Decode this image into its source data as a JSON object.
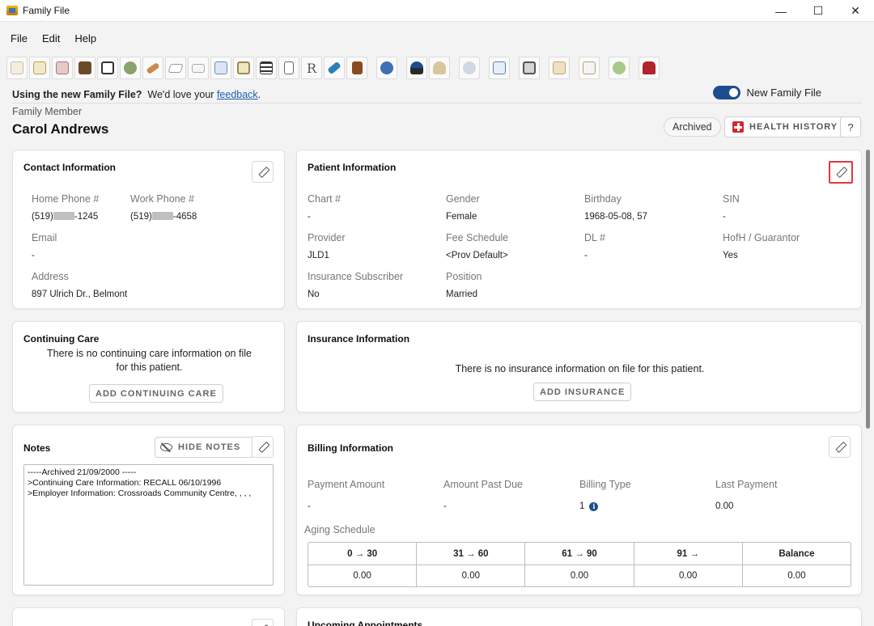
{
  "window": {
    "title": "Family File",
    "minimize": "—",
    "maximize": "☐",
    "close": "✕"
  },
  "menu": [
    "File",
    "Edit",
    "Help"
  ],
  "toolbar": {
    "icons": [
      "tooth-icon",
      "notepad-icon",
      "book-icon",
      "chair-icon",
      "id-card-icon",
      "globe-icon",
      "bandage-icon",
      "eraser-icon",
      "card-icon",
      "calendar-clock-icon",
      "camera-icon",
      "layout-icon",
      "document-icon",
      "rx-icon",
      "pen-icon",
      "door-icon",
      "info-icon",
      "person-icon",
      "family-icon",
      "people-icon",
      "calendar-icon",
      "printer-icon",
      "scroll-icon",
      "certificate-icon",
      "money-icon",
      "reader-icon"
    ],
    "rx_label": "R"
  },
  "banner": {
    "lead": "Using the new Family File?",
    "text": "We'd love your",
    "link": "feedback",
    "end": ".",
    "toggle_label": "New Family File"
  },
  "member": {
    "label": "Family Member",
    "name": "Carol Andrews"
  },
  "header_actions": {
    "archived": "Archived",
    "health_history": "HEALTH HISTORY",
    "help": "?"
  },
  "contact": {
    "title": "Contact Information",
    "home_phone_label": "Home Phone #",
    "home_phone_prefix": "(519)",
    "home_phone_suffix": "-1245",
    "work_phone_label": "Work Phone #",
    "work_phone_prefix": "(519)",
    "work_phone_suffix": "-4658",
    "email_label": "Email",
    "email_value": "-",
    "address_label": "Address",
    "address_value": "897 Ulrich Dr., Belmont"
  },
  "patient": {
    "title": "Patient Information",
    "fields": [
      {
        "label": "Chart #",
        "value": "-"
      },
      {
        "label": "Gender",
        "value": "Female"
      },
      {
        "label": "Birthday",
        "value": "1968-05-08, 57"
      },
      {
        "label": "SIN",
        "value": "-"
      },
      {
        "label": "Provider",
        "value": "JLD1"
      },
      {
        "label": "Fee Schedule",
        "value": "<Prov Default>"
      },
      {
        "label": "DL #",
        "value": "-"
      },
      {
        "label": "HofH / Guarantor",
        "value": "Yes"
      },
      {
        "label": "Insurance Subscriber",
        "value": "No"
      },
      {
        "label": "Position",
        "value": "Married"
      }
    ]
  },
  "continuing_care": {
    "title": "Continuing Care",
    "message_line1": "There is no continuing care information on file",
    "message_line2": "for this patient.",
    "button": "ADD CONTINUING CARE"
  },
  "insurance": {
    "title": "Insurance Information",
    "message": "There is no insurance information on file for this patient.",
    "button": "ADD INSURANCE"
  },
  "notes": {
    "title": "Notes",
    "hide_button": "HIDE NOTES",
    "lines": [
      "-----Archived 21/09/2000 -----",
      ">Continuing Care Information:  RECALL 06/10/1996",
      ">Employer Information: Crossroads Community Centre, , , ,"
    ]
  },
  "billing": {
    "title": "Billing Information",
    "payment_amount_label": "Payment Amount",
    "payment_amount_value": "-",
    "amount_past_due_label": "Amount Past Due",
    "amount_past_due_value": "-",
    "billing_type_label": "Billing Type",
    "billing_type_value": "1",
    "last_payment_label": "Last Payment",
    "last_payment_value": "0.00",
    "aging_label": "Aging Schedule",
    "aging_headers": [
      "0 → 30",
      "31 → 60",
      "61 → 90",
      "91 →",
      "Balance"
    ],
    "aging_values": [
      "0.00",
      "0.00",
      "0.00",
      "0.00",
      "0.00"
    ]
  },
  "upcoming": {
    "title": "Upcoming Appointments"
  }
}
